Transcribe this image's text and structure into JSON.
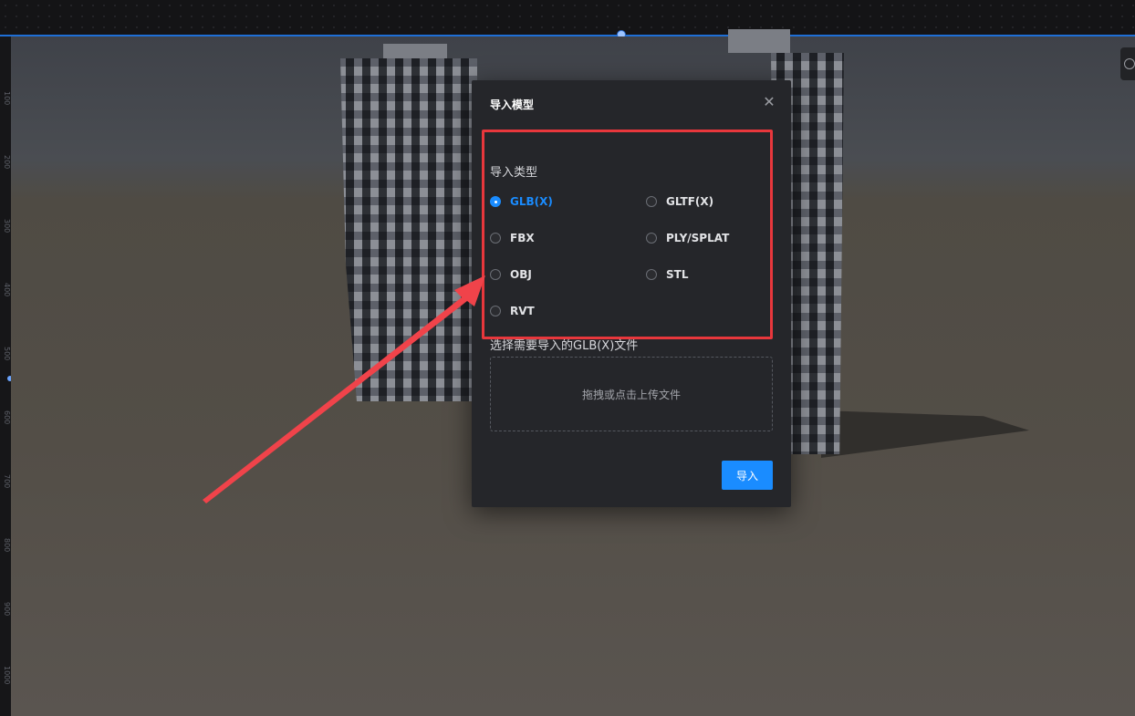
{
  "dialog": {
    "title": "导入模型",
    "close_glyph": "✕",
    "type_section_label": "导入类型",
    "types": [
      {
        "label": "GLB(X)",
        "selected": true
      },
      {
        "label": "GLTF(X)",
        "selected": false
      },
      {
        "label": "FBX",
        "selected": false
      },
      {
        "label": "PLY/SPLAT",
        "selected": false
      },
      {
        "label": "OBJ",
        "selected": false
      },
      {
        "label": "STL",
        "selected": false
      },
      {
        "label": "RVT",
        "selected": false
      }
    ],
    "file_section_label": "选择需要导入的GLB(X)文件",
    "upload_placeholder": "拖拽或点击上传文件",
    "import_button_label": "导入"
  },
  "colors": {
    "accent": "#1a8cff",
    "highlight_box": "#e8373c",
    "annotation_arrow": "#f0434a",
    "modal_background": "#25262a"
  },
  "icons": {
    "close": "close-icon",
    "radio": "radio-icon",
    "annotation": "arrow-annotation"
  }
}
